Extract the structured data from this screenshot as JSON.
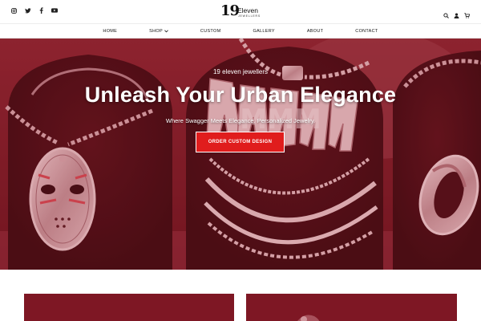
{
  "header": {
    "social_icons": [
      "instagram-icon",
      "twitter-icon",
      "facebook-icon",
      "youtube-icon"
    ],
    "logo": {
      "number": "19",
      "word": "Eleven",
      "tagline": "JEWELLERS"
    },
    "utility_icons": [
      "search-icon",
      "user-icon",
      "cart-icon"
    ]
  },
  "nav": {
    "items": [
      {
        "label": "HOME"
      },
      {
        "label": "SHOP"
      },
      {
        "label": "CUSTOM"
      },
      {
        "label": "GALLERY"
      },
      {
        "label": "ABOUT"
      },
      {
        "label": "CONTACT"
      }
    ]
  },
  "hero": {
    "eyebrow": "19 eleven jewellers",
    "headline": "Unleash Your Urban Elegance",
    "subheadline": "Where Swagger Meets Elegance. Personalized Jewelry.",
    "cta_label": "ORDER CUSTOM DESIGN",
    "overlay_color": "#8b1a26",
    "pendant_text": "MMM"
  },
  "colors": {
    "accent": "#e01d1d",
    "brand_red": "#7d1623"
  }
}
